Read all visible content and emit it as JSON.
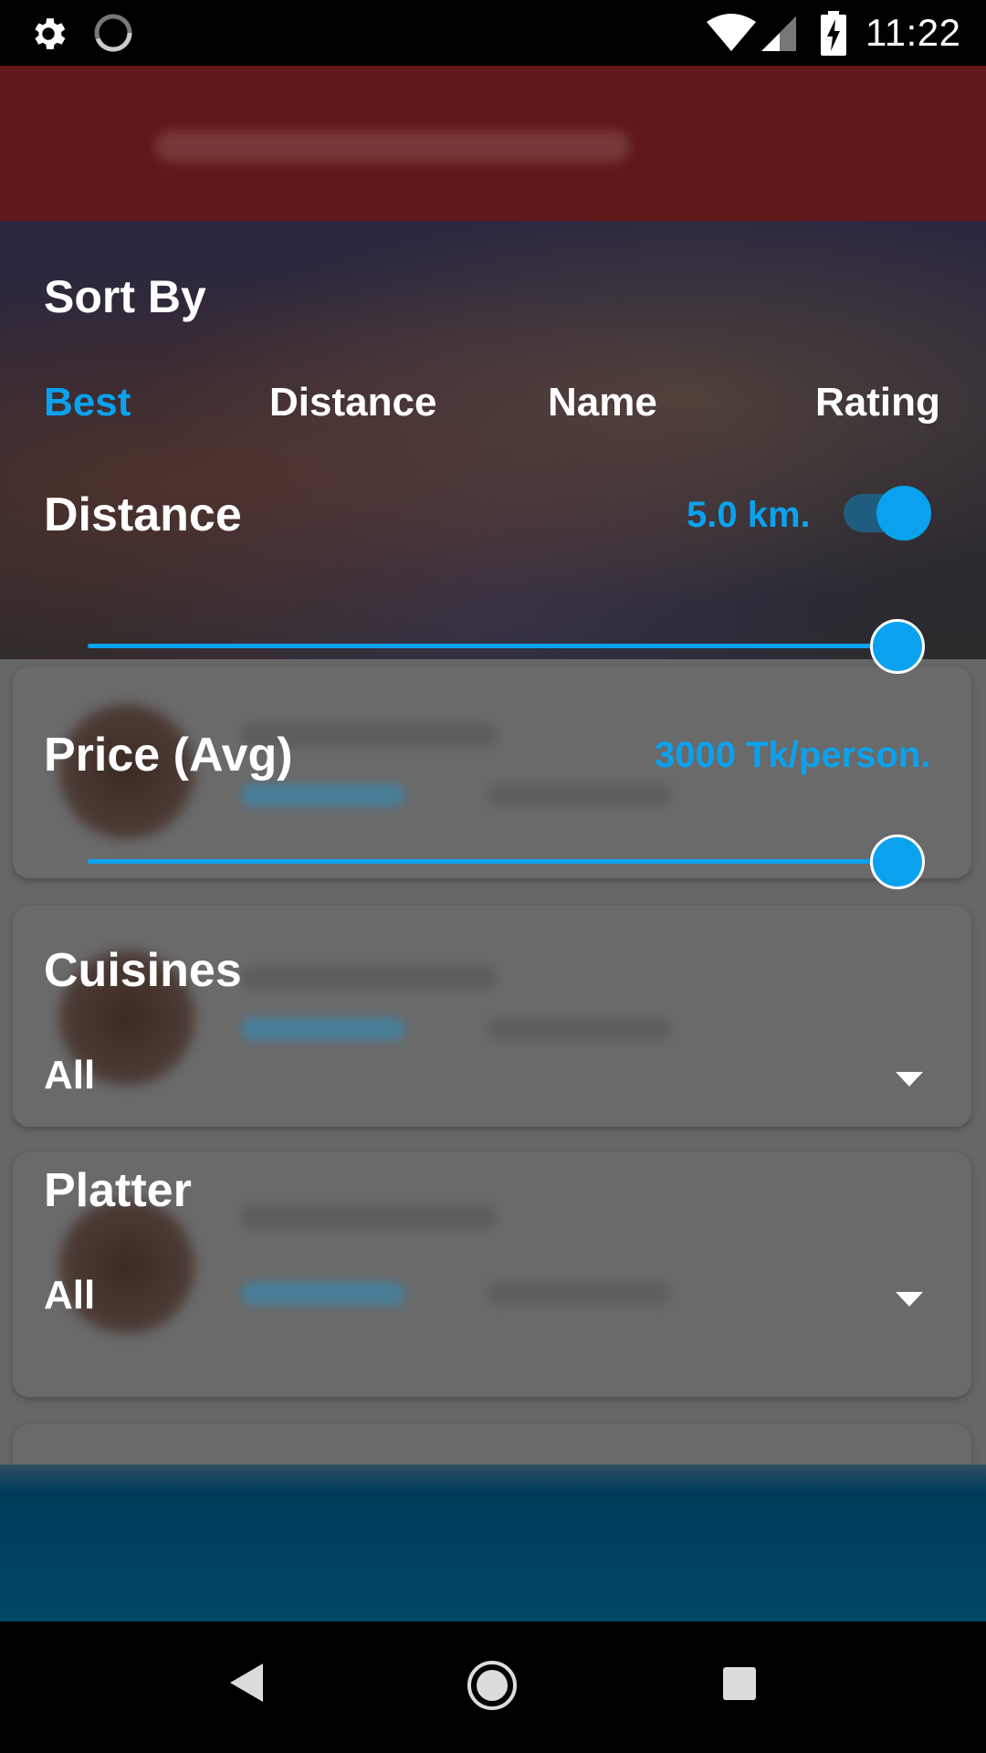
{
  "status_bar": {
    "time": "11:22",
    "icons": [
      "gear-icon",
      "loading-icon",
      "wifi-icon",
      "signal-icon",
      "battery-charging-icon"
    ]
  },
  "sort_by": {
    "title": "Sort By",
    "options": [
      "Best",
      "Distance",
      "Name",
      "Rating"
    ],
    "selected": "Best"
  },
  "distance": {
    "label": "Distance",
    "value": "5.0 km.",
    "enabled": true,
    "slider_fraction": 1.0
  },
  "price": {
    "label": "Price (Avg)",
    "value": "3000 Tk/person.",
    "slider_fraction": 1.0
  },
  "cuisines": {
    "label": "Cuisines",
    "selected": "All"
  },
  "platter": {
    "label": "Platter",
    "selected": "All"
  },
  "colors": {
    "accent": "#0aa2ee",
    "overlay": "#666666",
    "toolbar": "#601818",
    "bottom_bar": "#004766"
  },
  "nav_bar": {
    "icons": [
      "back-icon",
      "home-icon",
      "recents-icon"
    ]
  }
}
